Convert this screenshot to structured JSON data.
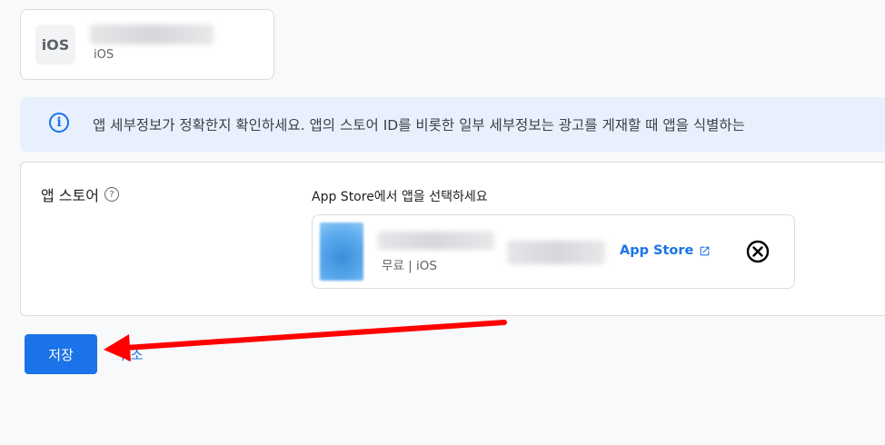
{
  "platform_card": {
    "icon_text": "iOS",
    "platform": "iOS"
  },
  "info_banner": {
    "icon": "info-icon",
    "text": "앱 세부정보가 정확한지 확인하세요. 앱의 스토어 ID를 비롯한 일부 세부정보는 광고를 게재할 때 앱을 식별하는"
  },
  "app_store_section": {
    "label": "앱 스토어",
    "help_icon": "help-icon",
    "select_prompt": "App Store에서 앱을 선택하세요",
    "selected_app": {
      "meta": "무료 | iOS",
      "store_link": "App Store",
      "remove_icon": "close-circle-icon"
    }
  },
  "actions": {
    "save_label": "저장",
    "cancel_label": "취소"
  },
  "annotation": {
    "color": "#ff0000",
    "icon": "arrow-icon"
  },
  "colors": {
    "accent": "#1a73e8",
    "banner_bg": "#e8f0fe",
    "page_bg": "#f8f9fa"
  }
}
